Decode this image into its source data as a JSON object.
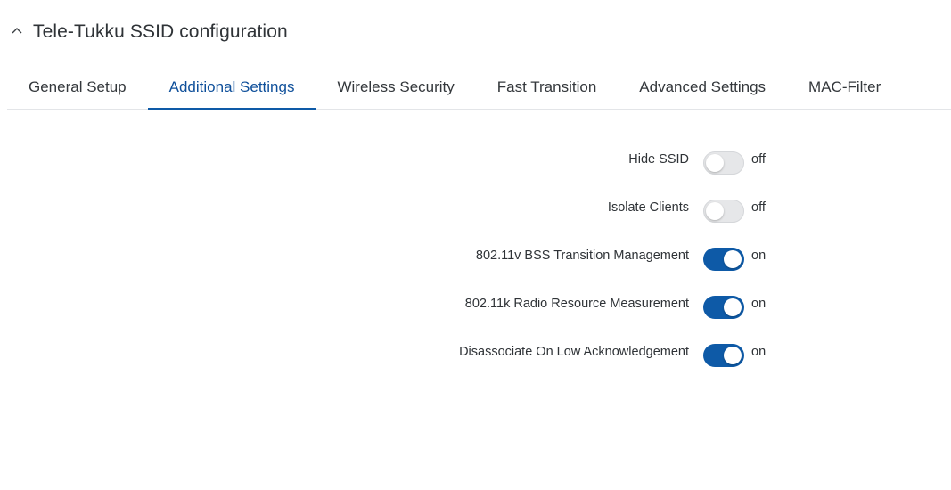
{
  "section": {
    "title": "Tele-Tukku SSID configuration",
    "collapse_icon": "chevron-up-icon"
  },
  "tabs": [
    {
      "label": "General Setup",
      "active": false
    },
    {
      "label": "Additional Settings",
      "active": true
    },
    {
      "label": "Wireless Security",
      "active": false
    },
    {
      "label": "Fast Transition",
      "active": false
    },
    {
      "label": "Advanced Settings",
      "active": false
    },
    {
      "label": "MAC-Filter",
      "active": false
    }
  ],
  "settings": [
    {
      "label": "Hide SSID",
      "enabled": false,
      "state_text": "off"
    },
    {
      "label": "Isolate Clients",
      "enabled": false,
      "state_text": "off"
    },
    {
      "label": "802.11v BSS Transition Management",
      "enabled": true,
      "state_text": "on"
    },
    {
      "label": "802.11k Radio Resource Measurement",
      "enabled": true,
      "state_text": "on"
    },
    {
      "label": "Disassociate On Low Acknowledgement",
      "enabled": true,
      "state_text": "on"
    }
  ],
  "colors": {
    "accent": "#0e5aa7",
    "active_tab_text": "#0e4f9a",
    "toggle_off": "#e6e7e9"
  }
}
